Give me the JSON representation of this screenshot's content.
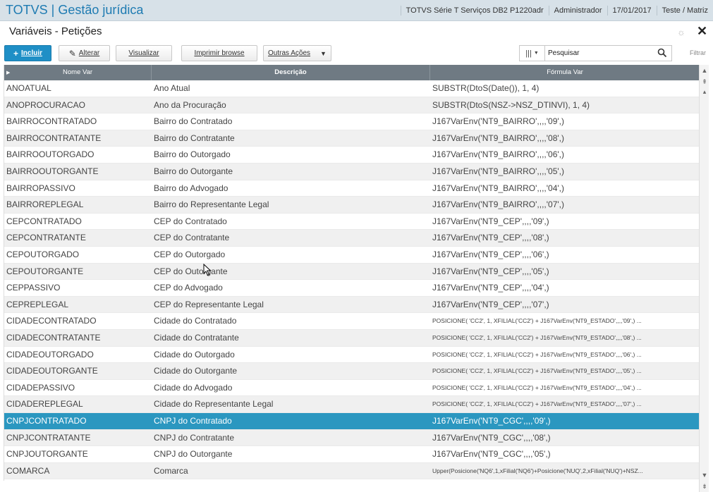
{
  "header": {
    "app_title": "TOTVS | Gestão jurídica",
    "system": "TOTVS Série T Serviços DB2 P1220adr",
    "user": "Administrador",
    "date": "17/01/2017",
    "branch": "Teste / Matriz"
  },
  "page": {
    "title": "Variáveis - Petições"
  },
  "toolbar": {
    "incluir": "Incluir",
    "alterar": "Alterar",
    "visualizar": "Visualizar",
    "imprimir": "Imprimir browse",
    "outras": "Outras Ações"
  },
  "search": {
    "placeholder": "Pesquisar",
    "filtrar": "Filtrar"
  },
  "columns": [
    "Nome Var",
    "Descrição",
    "Fórmula Var"
  ],
  "rows": [
    [
      "ANOATUAL",
      "Ano Atual",
      "SUBSTR(DtoS(Date()), 1, 4)"
    ],
    [
      "ANOPROCURACAO",
      "Ano da Procuração",
      "SUBSTR(DtoS(NSZ->NSZ_DTINVI), 1, 4)"
    ],
    [
      "BAIRROCONTRATADO",
      "Bairro do Contratado",
      "J167VarEnv('NT9_BAIRRO',,,,'09',)"
    ],
    [
      "BAIRROCONTRATANTE",
      "Bairro do Contratante",
      "J167VarEnv('NT9_BAIRRO',,,,'08',)"
    ],
    [
      "BAIRROOUTORGADO",
      "Bairro do Outorgado",
      "J167VarEnv('NT9_BAIRRO',,,,'06',)"
    ],
    [
      "BAIRROOUTORGANTE",
      "Bairro do Outorgante",
      "J167VarEnv('NT9_BAIRRO',,,,'05',)"
    ],
    [
      "BAIRROPASSIVO",
      "Bairro do Advogado",
      "J167VarEnv('NT9_BAIRRO',,,,'04',)"
    ],
    [
      "BAIRROREPLEGAL",
      "Bairro do Representante Legal",
      "J167VarEnv('NT9_BAIRRO',,,,'07',)"
    ],
    [
      "CEPCONTRATADO",
      "CEP do Contratado",
      "J167VarEnv('NT9_CEP',,,,'09',)"
    ],
    [
      "CEPCONTRATANTE",
      "CEP do Contratante",
      "J167VarEnv('NT9_CEP',,,,'08',)"
    ],
    [
      "CEPOUTORGADO",
      "CEP do Outorgado",
      "J167VarEnv('NT9_CEP',,,,'06',)"
    ],
    [
      "CEPOUTORGANTE",
      "CEP do Outorgante",
      "J167VarEnv('NT9_CEP',,,,'05',)"
    ],
    [
      "CEPPASSIVO",
      "CEP do Advogado",
      "J167VarEnv('NT9_CEP',,,,'04',)"
    ],
    [
      "CEPREPLEGAL",
      "CEP do Representante Legal",
      "J167VarEnv('NT9_CEP',,,,'07',)"
    ],
    [
      "CIDADECONTRATADO",
      "Cidade do Contratado",
      "POSICIONE( 'CC2', 1, XFILIAL('CC2') + J167VarEnv('NT9_ESTADO',,,,'09',) ..."
    ],
    [
      "CIDADECONTRATANTE",
      "Cidade do Contratante",
      "POSICIONE( 'CC2', 1, XFILIAL('CC2') + J167VarEnv('NT9_ESTADO',,,,'08',) ..."
    ],
    [
      "CIDADEOUTORGADO",
      "Cidade do Outorgado",
      "POSICIONE( 'CC2', 1, XFILIAL('CC2') + J167VarEnv('NT9_ESTADO',,,,'06',) ..."
    ],
    [
      "CIDADEOUTORGANTE",
      "Cidade do Outorgante",
      "POSICIONE( 'CC2', 1, XFILIAL('CC2') + J167VarEnv('NT9_ESTADO',,,,'05',) ..."
    ],
    [
      "CIDADEPASSIVO",
      "Cidade do Advogado",
      "POSICIONE( 'CC2', 1, XFILIAL('CC2') + J167VarEnv('NT9_ESTADO',,,,'04',) ..."
    ],
    [
      "CIDADEREPLEGAL",
      "Cidade do Representante Legal",
      "POSICIONE( 'CC2', 1, XFILIAL('CC2') + J167VarEnv('NT9_ESTADO',,,,'07',) ..."
    ],
    [
      "CNPJCONTRATADO",
      "CNPJ do Contratado",
      "J167VarEnv('NT9_CGC',,,,'09',)"
    ],
    [
      "CNPJCONTRATANTE",
      "CNPJ do Contratante",
      "J167VarEnv('NT9_CGC',,,,'08',)"
    ],
    [
      "CNPJOUTORGANTE",
      "CNPJ do Outorgante",
      "J167VarEnv('NT9_CGC',,,,'05',)"
    ],
    [
      "COMARCA",
      "Comarca",
      "Upper(Posicione('NQ6',1,xFilial('NQ6')+Posicione('NUQ',2,xFilial('NUQ')+NSZ..."
    ]
  ],
  "selected_row": 20,
  "colors": {
    "accent": "#1f8fc6",
    "header_bg": "#6f7a83",
    "selected": "#2b97c0"
  }
}
